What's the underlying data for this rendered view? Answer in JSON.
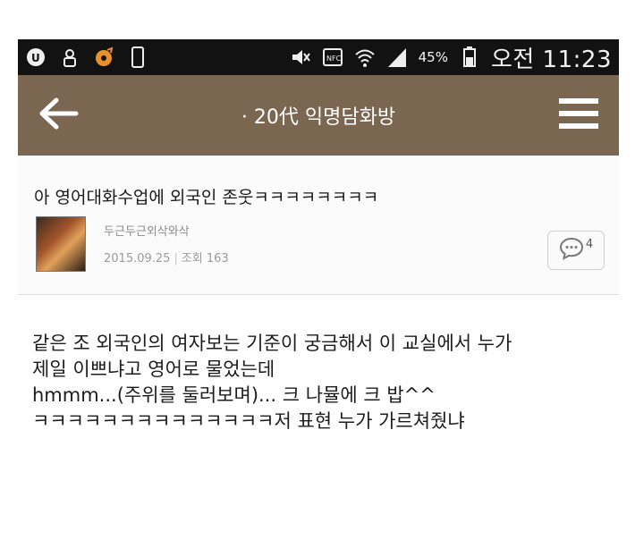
{
  "status_bar": {
    "icons": [
      "u-plus-icon",
      "lock-person-icon",
      "music-app-icon",
      "phone-icon",
      "mute-icon",
      "nfc-icon",
      "wifi-icon",
      "signal-icon",
      "battery-icon"
    ],
    "battery": "45%",
    "time": "오전 11:23"
  },
  "app_bar": {
    "title": "· 20代 익명담화방",
    "back_icon": "arrow-left-icon",
    "menu_icon": "hamburger-icon",
    "bar_color": "#7a6651"
  },
  "post": {
    "title": "아 영어대화수업에 외국인 존웃ㅋㅋㅋㅋㅋㅋㅋㅋ",
    "author": "두근두근외삭와삭",
    "date": "2015.09.25",
    "views": "조회 163",
    "comment_count": "4",
    "body": [
      "같은 조 외국인의 여자보는 기준이 궁금해서 이 교실에서 누가",
      "제일 이쁘냐고 영어로 물었는데",
      "hmmm...(주위를 둘러보며)... 크 나뮬에 크 밥^^",
      "ㅋㅋㅋㅋㅋㅋㅋㅋㅋㅋㅋㅋㅋㅋ저 표현 누가 가르쳐줬냐"
    ]
  }
}
